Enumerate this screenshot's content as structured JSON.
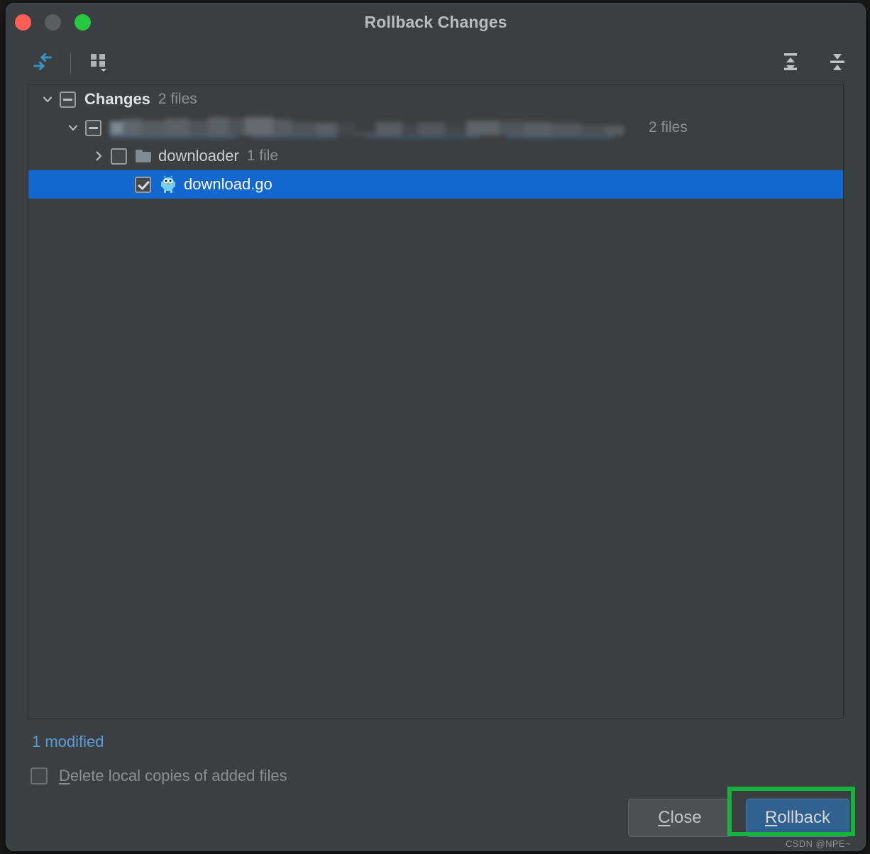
{
  "window": {
    "title": "Rollback Changes",
    "traffic_lights": [
      {
        "name": "close",
        "color": "#ff5f57"
      },
      {
        "name": "minimize",
        "color": "#5a5e60"
      },
      {
        "name": "maximize",
        "color": "#28c840"
      }
    ]
  },
  "toolbar": {
    "left_items": [
      {
        "icon": "collapse-arrows-icon",
        "label": ""
      },
      {
        "icon": "group-by-grid-icon",
        "label": ""
      }
    ],
    "right_items": [
      {
        "icon": "expand-all-icon",
        "label": ""
      },
      {
        "icon": "collapse-all-icon",
        "label": ""
      }
    ]
  },
  "tree": {
    "rows": [
      {
        "id": "changes",
        "indent": 0,
        "twisty": "expanded",
        "checkbox": "indeterminate",
        "icon": "none",
        "label": "Changes",
        "count": "2 files",
        "selected": false,
        "redacted": false
      },
      {
        "id": "redacted-changelist",
        "indent": 1,
        "twisty": "expanded",
        "checkbox": "indeterminate",
        "icon": "none",
        "label": "",
        "count": "2 files",
        "selected": false,
        "redacted": true
      },
      {
        "id": "downloader",
        "indent": 2,
        "twisty": "collapsed",
        "checkbox": "unchecked",
        "icon": "folder-icon",
        "label": "downloader",
        "count": "1 file",
        "selected": false,
        "redacted": false
      },
      {
        "id": "download-go",
        "indent": 3,
        "twisty": "none",
        "checkbox": "checked",
        "icon": "go-gopher-icon",
        "label": "download.go",
        "count": "",
        "selected": true,
        "redacted": false
      }
    ]
  },
  "status": {
    "text": "1 modified",
    "color": "#5a9dd6"
  },
  "options": {
    "delete_local_copies": {
      "checked": false,
      "mnemonic": "D",
      "label_rest": "elete local copies of added files"
    }
  },
  "buttons": {
    "close": {
      "mnemonic": "C",
      "label_rest": "lose"
    },
    "rollback": {
      "mnemonic": "R",
      "label_rest": "ollback"
    }
  },
  "annotation": {
    "highlight_color": "#16b03c",
    "highlight_target": "rollback-button"
  },
  "watermark": {
    "text": "CSDN @NPE~"
  }
}
